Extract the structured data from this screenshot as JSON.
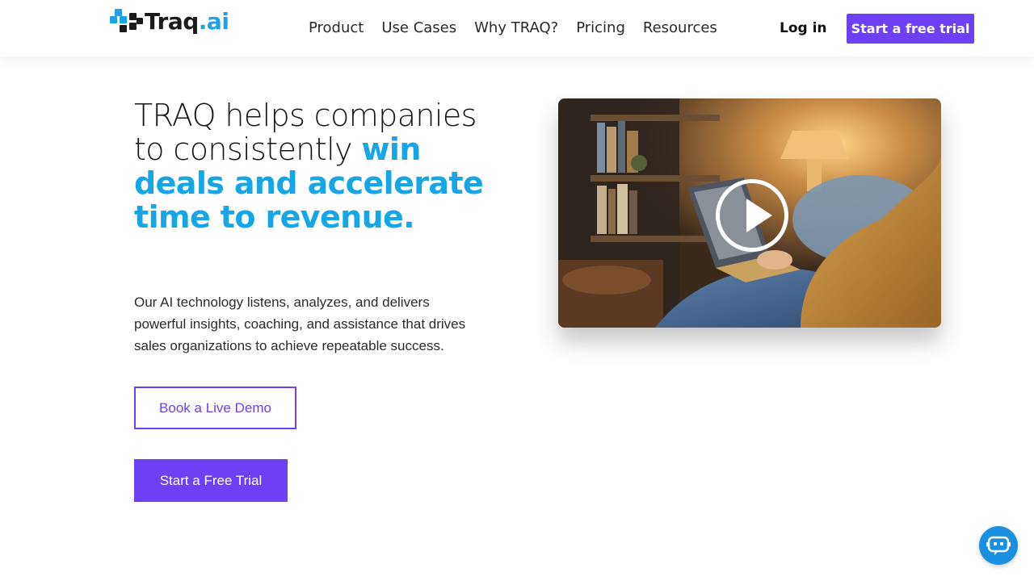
{
  "brand": {
    "logo_text_main": "Traq",
    "logo_text_suffix": ".ai",
    "colors": {
      "accent": "#6d3ff5",
      "highlight": "#14a6e6",
      "logo_blue": "#1aa3e8",
      "chat": "#1b8fe0"
    }
  },
  "nav": {
    "items": [
      {
        "label": "Product"
      },
      {
        "label": "Use Cases"
      },
      {
        "label": "Why TRAQ?"
      },
      {
        "label": "Pricing"
      },
      {
        "label": "Resources"
      }
    ],
    "login_label": "Log in",
    "trial_label": "Start a free trial"
  },
  "hero": {
    "headline_plain": "TRAQ helps companies to consistently ",
    "headline_highlight": "win deals and accelerate time to revenue.",
    "subtext": "Our AI technology listens, analyzes, and delivers powerful insights, coaching, and assistance that drives sales organizations to achieve repeatable success.",
    "demo_button": "Book a Live Demo",
    "trial_button": "Start a Free Trial"
  },
  "video": {
    "play_icon": "play-icon"
  },
  "chat_widget": {
    "icon": "chat-bot-icon"
  }
}
